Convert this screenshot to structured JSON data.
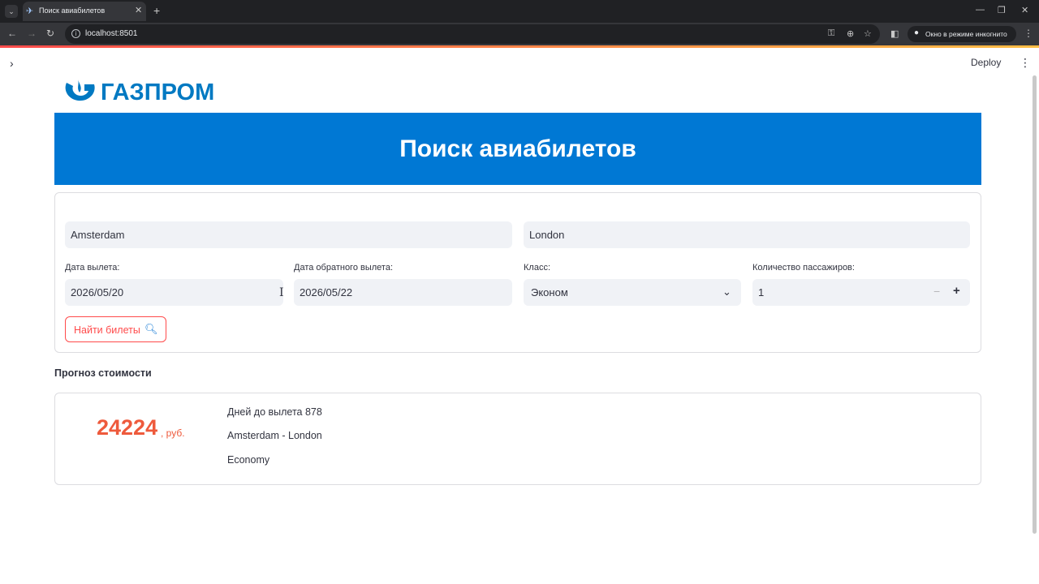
{
  "browser": {
    "tab_title": "Поиск авиабилетов",
    "url": "localhost:8501",
    "incognito_label": "Окно в режиме инкогнито"
  },
  "header": {
    "deploy_label": "Deploy"
  },
  "logo": {
    "text": "ГАЗПРОМ",
    "color": "#0079c2"
  },
  "banner": {
    "title": "Поиск авиабилетов",
    "color": "#0078d4"
  },
  "form": {
    "from_value": "Amsterdam",
    "to_value": "London",
    "departure_label": "Дата вылета:",
    "departure_value": "2026/05/20",
    "return_label": "Дата обратного вылета:",
    "return_value": "2026/05/22",
    "class_label": "Класс:",
    "class_value": "Эконом",
    "passengers_label": "Количество пассажиров:",
    "passengers_value": "1",
    "search_button_label": "Найти билеты"
  },
  "forecast": {
    "title": "Прогноз стоимости",
    "price": "24224",
    "price_unit": ", руб.",
    "price_color": "#ee5a3c",
    "days_to_departure": "Дней до вылета 878",
    "route": "Amsterdam - London",
    "class": "Economy"
  },
  "icons": {
    "tab_favicon": "airplane-icon",
    "search_button_icon": "magnifier-icon"
  }
}
